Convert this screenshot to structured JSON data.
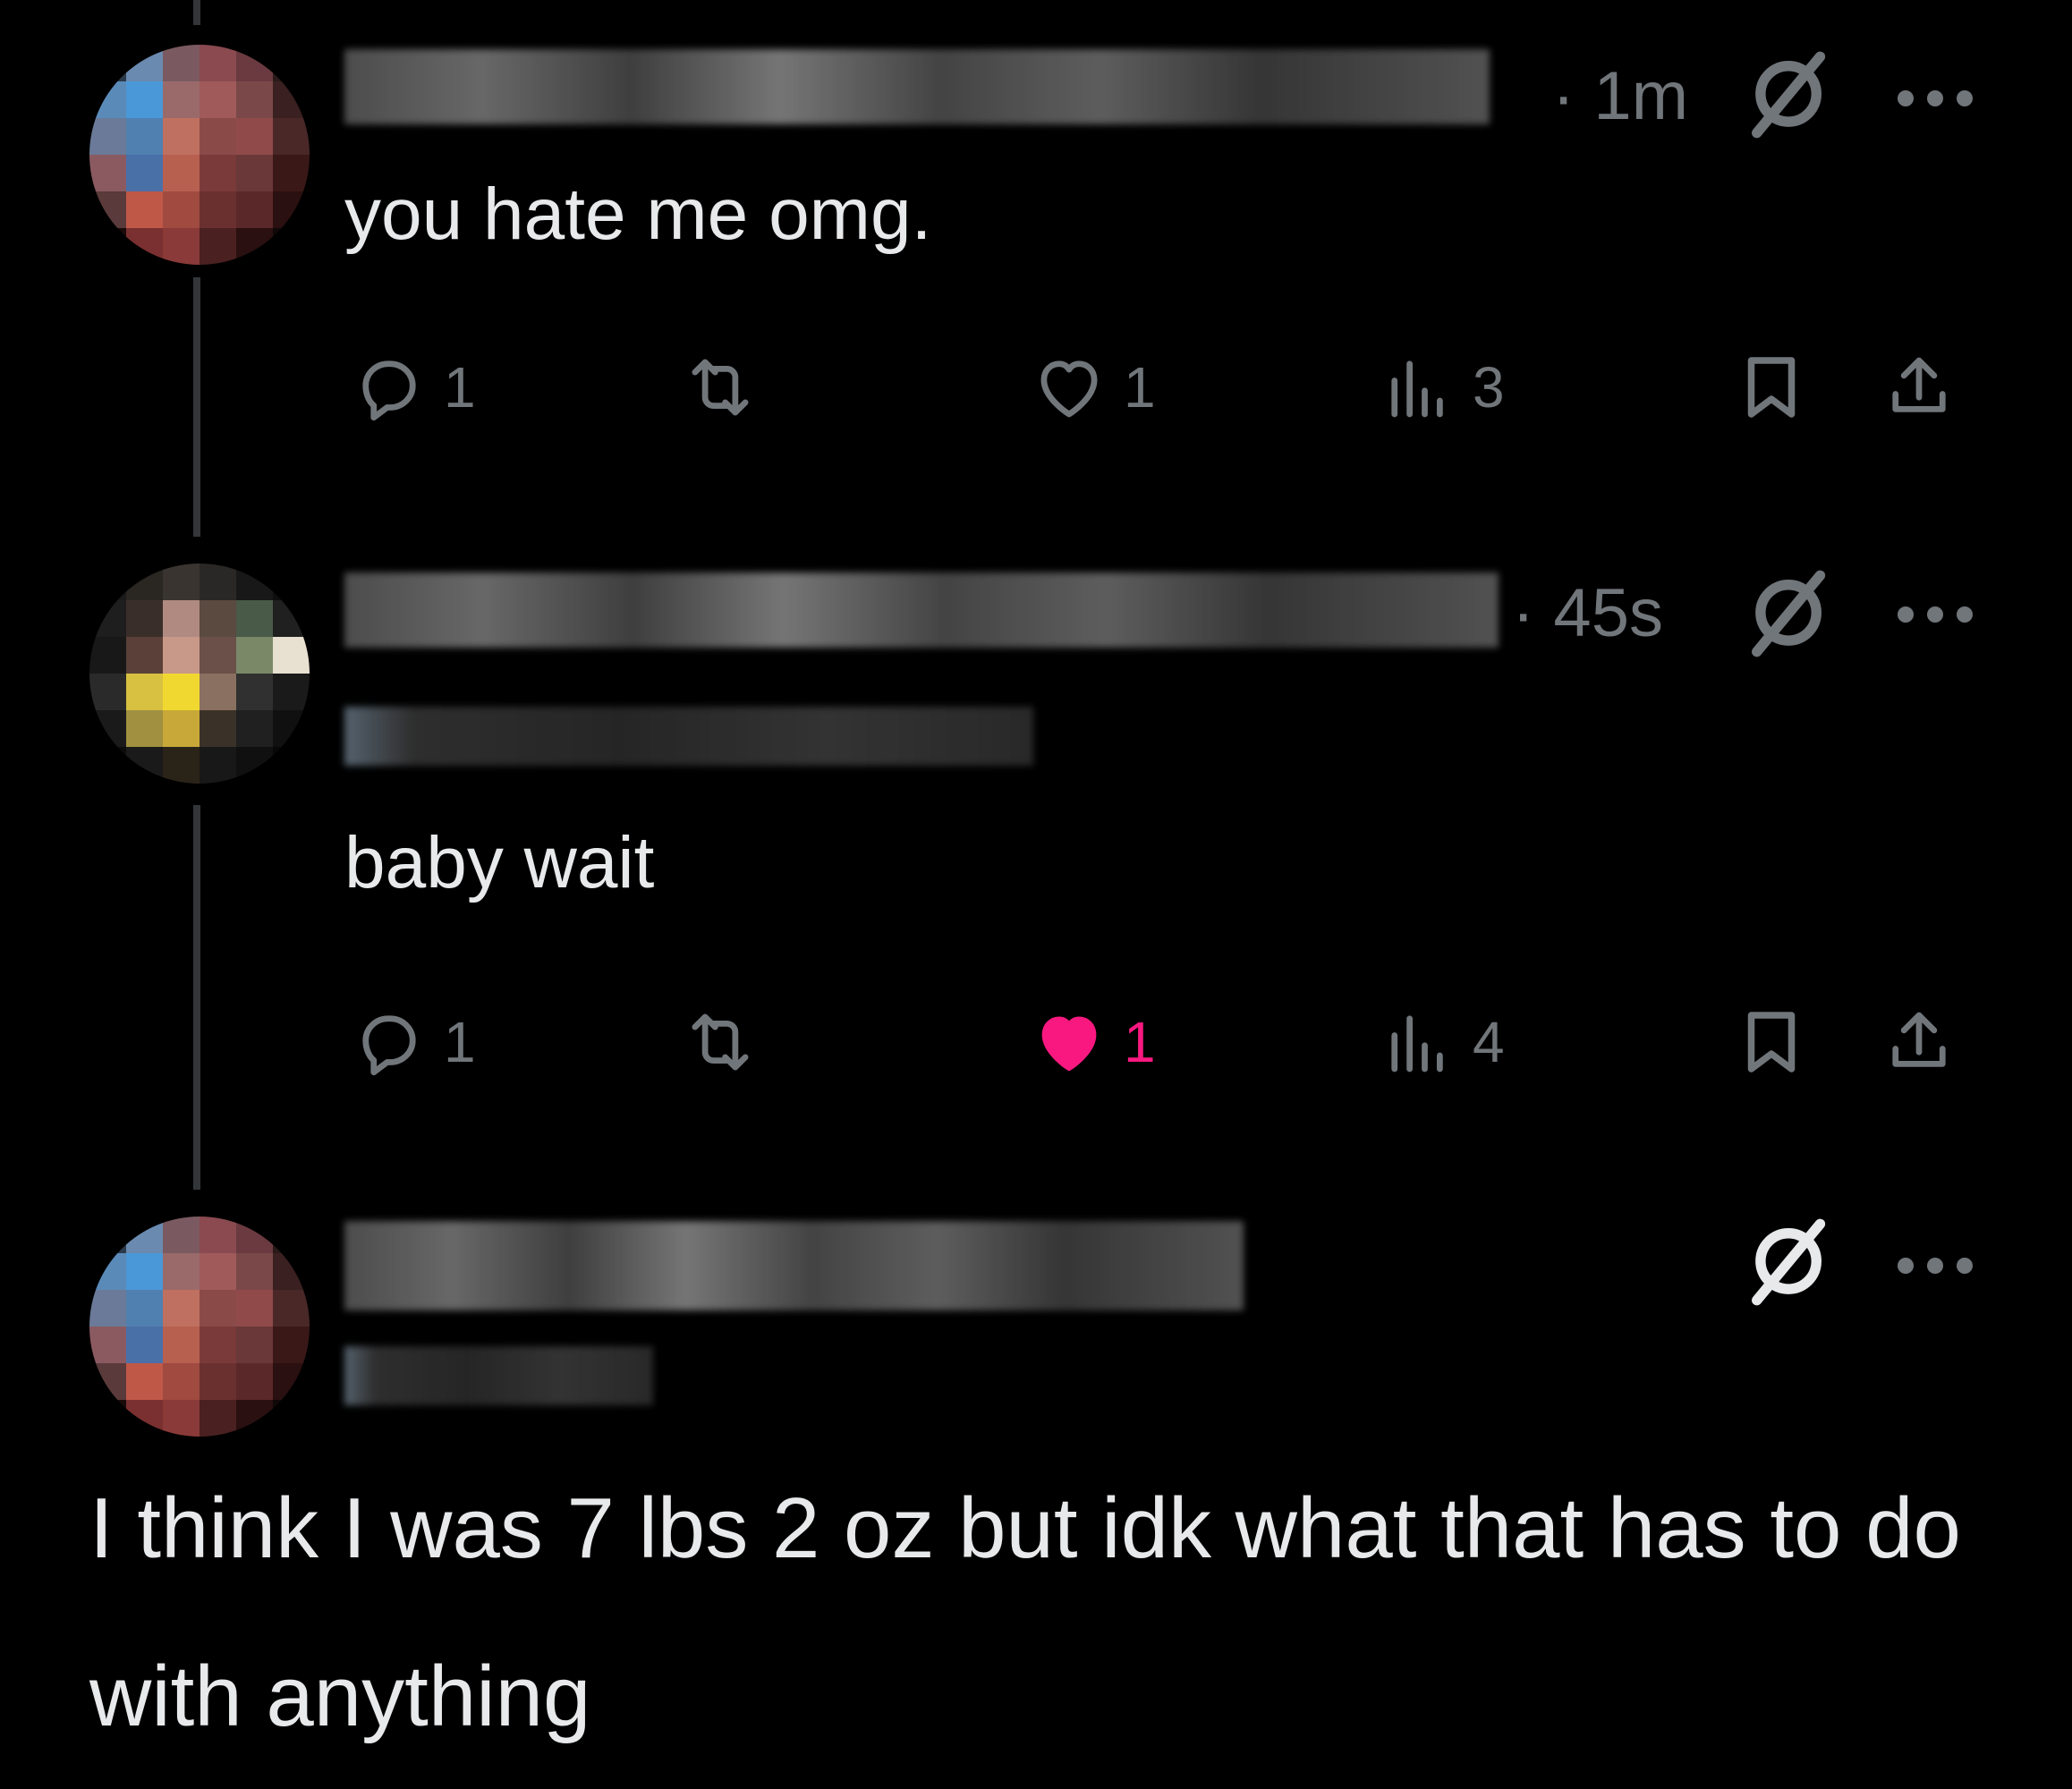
{
  "posts": [
    {
      "timestamp": "· 1m",
      "text": "you hate me omg.",
      "actions": {
        "replies": "1",
        "reposts": "",
        "likes": "1",
        "views": "3",
        "liked": false
      }
    },
    {
      "timestamp": "· 45s",
      "text": "baby wait",
      "actions": {
        "replies": "1",
        "reposts": "",
        "likes": "1",
        "views": "4",
        "liked": true
      }
    }
  ],
  "main_post": {
    "text": "I think I was 7 lbs 2 oz but idk what that has to do with anything"
  },
  "icons": {
    "reply": "reply-icon",
    "repost": "repost-icon",
    "like": "heart-icon",
    "views": "views-icon",
    "bookmark": "bookmark-icon",
    "share": "share-icon",
    "grok": "grok-icon",
    "more": "more-icon"
  },
  "colors": {
    "background": "#000000",
    "text": "#e7e9ea",
    "muted": "#71767b",
    "like_active": "#f91880",
    "thread_line": "#333639"
  }
}
